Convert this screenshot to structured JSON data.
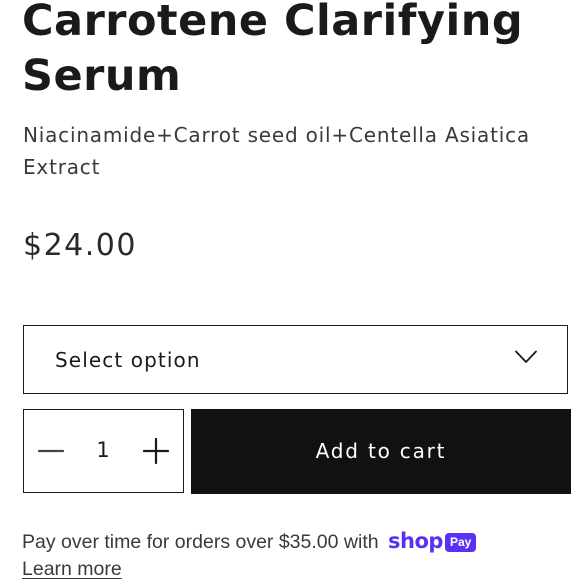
{
  "product": {
    "title": "Carrotene Clarifying Serum",
    "subtitle": "Niacinamide+Carrot seed oil+Centella Asiatica Extract",
    "price": "$24.00"
  },
  "variant_select": {
    "label": "Select option",
    "icon": "chevron-down-icon"
  },
  "quantity": {
    "value": "1",
    "decrease_icon": "minus-icon",
    "increase_icon": "plus-icon"
  },
  "add_to_cart": {
    "label": "Add to cart",
    "background_color": "#111111",
    "text_color": "#ffffff"
  },
  "installments": {
    "text": "Pay over time for orders over $35.00 with",
    "brand_shop": "shop",
    "brand_pay": "Pay",
    "brand_color": "#5a31f4",
    "learn_more": "Learn more"
  }
}
